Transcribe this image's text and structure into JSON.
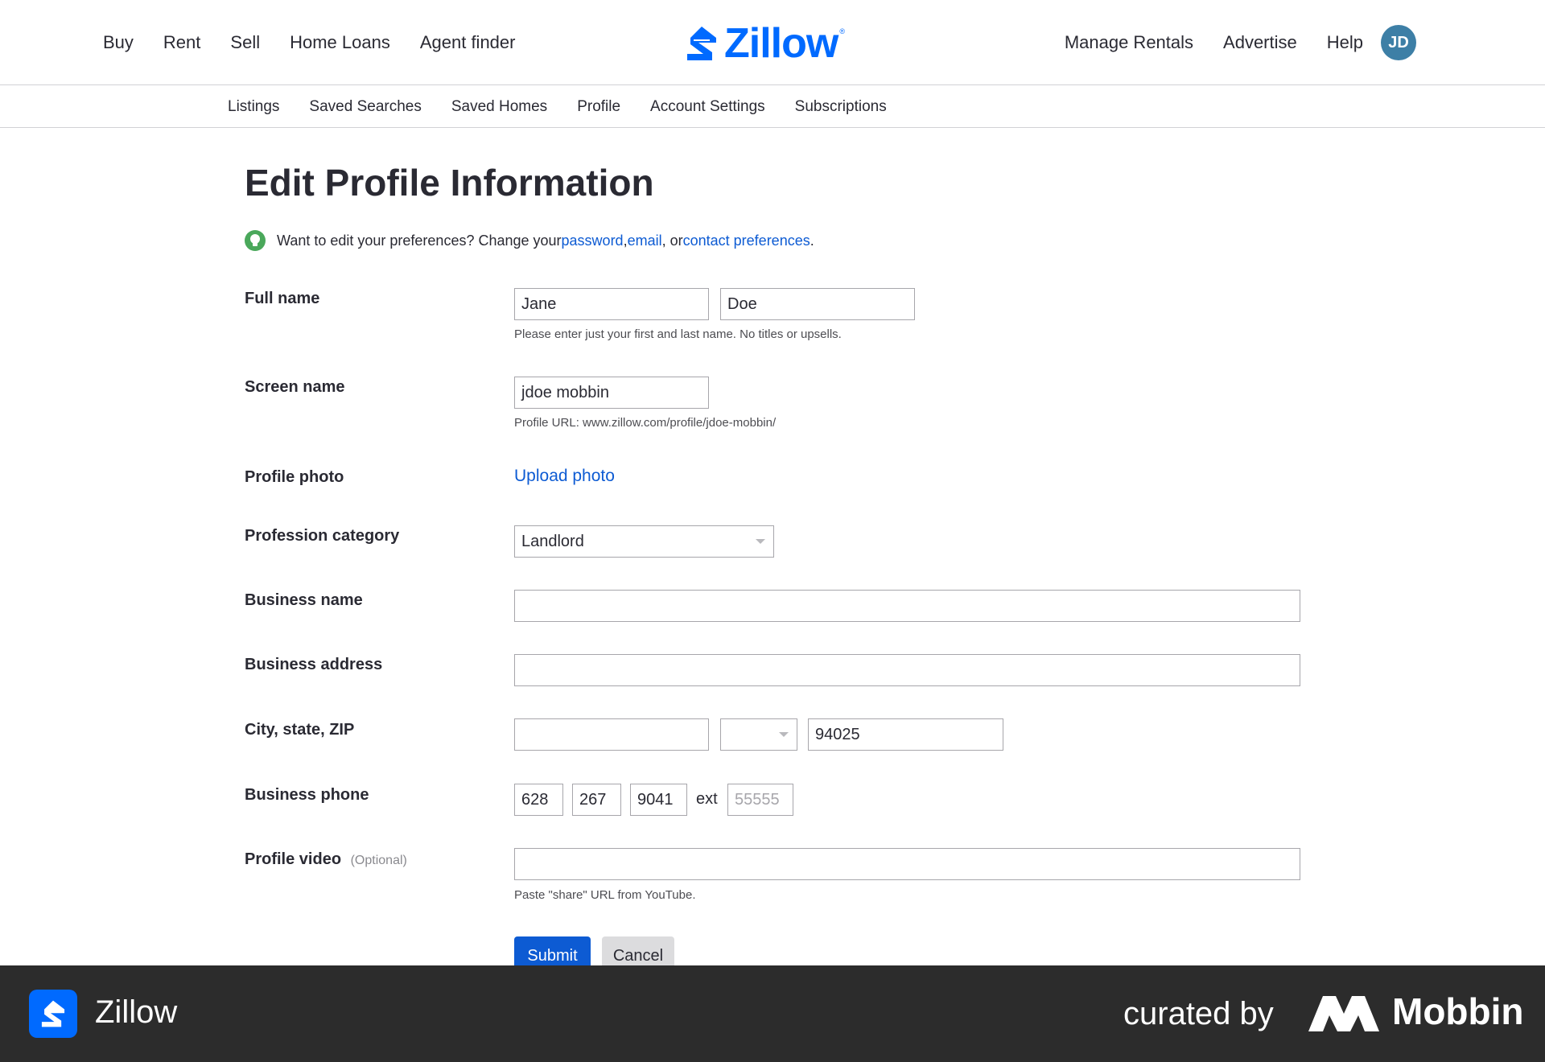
{
  "topnav": {
    "left": [
      "Buy",
      "Rent",
      "Sell",
      "Home Loans",
      "Agent finder"
    ],
    "right": [
      "Manage Rentals",
      "Advertise",
      "Help"
    ],
    "avatar_initials": "JD",
    "logo_text": "Zillow",
    "logo_reg": "®",
    "brand_color": "#006aff"
  },
  "subnav": [
    "Listings",
    "Saved Searches",
    "Saved Homes",
    "Profile",
    "Account Settings",
    "Subscriptions"
  ],
  "page_title": "Edit Profile Information",
  "hint": {
    "prefix": "Want to edit your preferences? Change your ",
    "password": "password",
    "sep1": ", ",
    "email": "email",
    "sep2": ", or ",
    "contact": "contact preferences",
    "suffix": "."
  },
  "form": {
    "full_name": {
      "label": "Full name",
      "first": "Jane",
      "last": "Doe",
      "help": "Please enter just your first and last name. No titles or upsells."
    },
    "screen_name": {
      "label": "Screen name",
      "value": "jdoe mobbin",
      "help": "Profile URL: www.zillow.com/profile/jdoe-mobbin/"
    },
    "profile_photo": {
      "label": "Profile photo",
      "link": "Upload photo"
    },
    "profession": {
      "label": "Profession category",
      "value": "Landlord"
    },
    "business_name": {
      "label": "Business name",
      "value": ""
    },
    "business_address": {
      "label": "Business address",
      "value": ""
    },
    "city_state_zip": {
      "label": "City, state, ZIP",
      "city": "",
      "state": "",
      "zip": "94025"
    },
    "business_phone": {
      "label": "Business phone",
      "area": "628",
      "prefix": "267",
      "line": "9041",
      "ext_label": "ext",
      "ext_placeholder": "55555"
    },
    "profile_video": {
      "label": "Profile video",
      "optional": "(Optional)",
      "value": "",
      "help": "Paste \"share\" URL from YouTube."
    },
    "submit": "Submit",
    "cancel": "Cancel"
  },
  "banner": {
    "app_name": "Zillow",
    "curated": "curated by",
    "mobbin": "Mobbin"
  }
}
